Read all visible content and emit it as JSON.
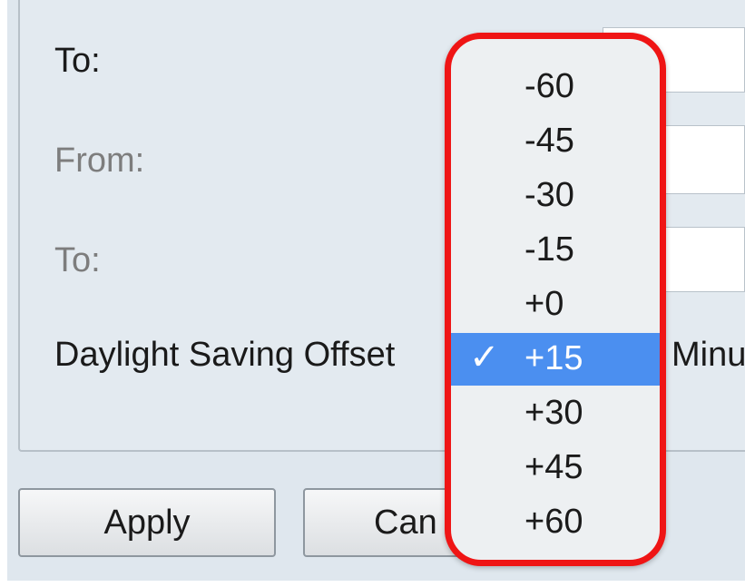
{
  "form": {
    "to_label_1": "To:",
    "from_label": "From:",
    "to_label_2": "To:",
    "offset_label": "Daylight Saving Offset",
    "offset_unit_partial": "Minu"
  },
  "buttons": {
    "apply": "Apply",
    "cancel_partial": "Can"
  },
  "dropdown": {
    "options": [
      "-60",
      "-45",
      "-30",
      "-15",
      "+0",
      "+15",
      "+30",
      "+45",
      "+60"
    ],
    "selected": "+15",
    "check_glyph": "✓"
  },
  "colors": {
    "highlight_outline": "#ef1515",
    "selected_bg": "#4b8ff0"
  }
}
